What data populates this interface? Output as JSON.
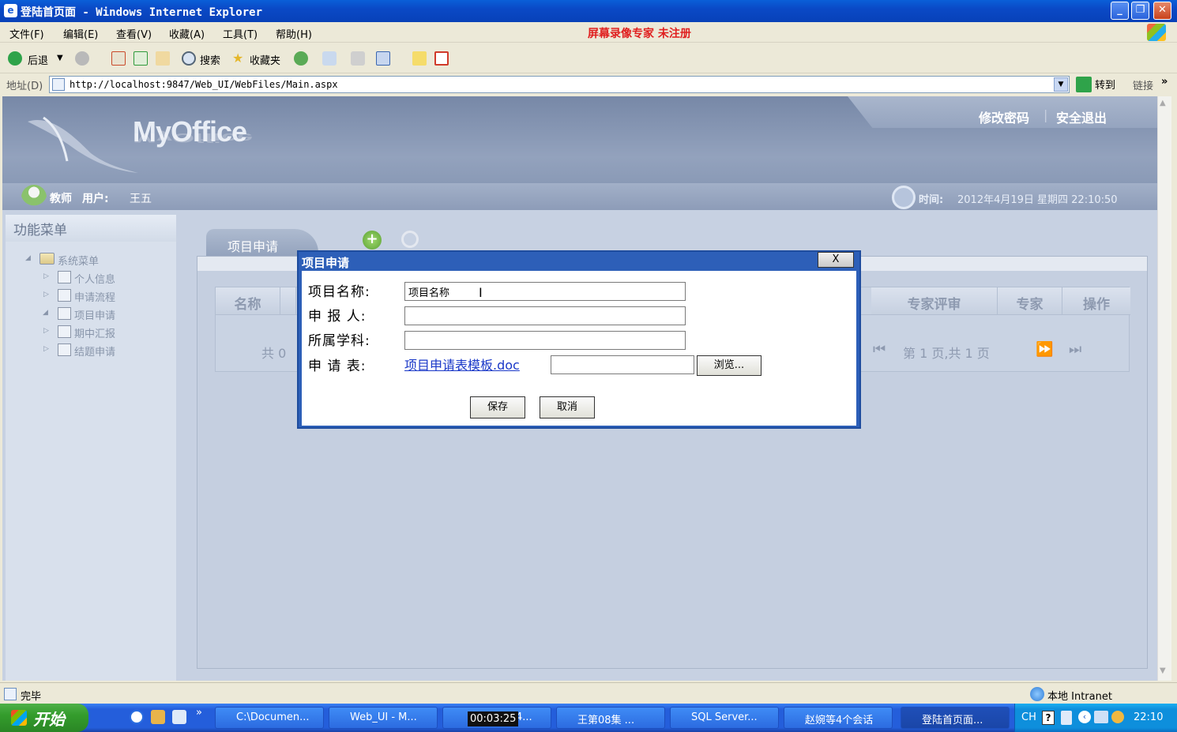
{
  "window": {
    "title": "登陆首页面 - Windows Internet Explorer",
    "min": "_",
    "max": "❐",
    "close": "✕"
  },
  "menubar": {
    "items": [
      "文件(F)",
      "编辑(E)",
      "查看(V)",
      "收藏(A)",
      "工具(T)",
      "帮助(H)"
    ],
    "recorder_watermark": "屏幕录像专家  未注册"
  },
  "toolbar": {
    "back": "后退",
    "search": "搜索",
    "favorites": "收藏夹"
  },
  "address": {
    "label": "地址(D)",
    "url": "http://localhost:9847/Web_UI/WebFiles/Main.aspx",
    "go": "转到",
    "links": "链接"
  },
  "header": {
    "logo": "MyOffice",
    "change_password": "修改密码",
    "separator": "|",
    "logout": "安全退出"
  },
  "userbar": {
    "role": "教师",
    "user_label": "用户:",
    "user_name": "王五",
    "time_label": "时间:",
    "time_value": "2012年4月19日 星期四 22:10:50"
  },
  "left_menu": {
    "title": "功能菜单",
    "root": "系统菜单",
    "items": [
      "个人信息",
      "申请流程",
      "项目申请",
      "期中汇报",
      "结题申请"
    ]
  },
  "main": {
    "tab": "项目申请",
    "grid_headers": [
      "名称",
      "专家评审",
      "专家",
      "操作"
    ],
    "pager_left": "共 0",
    "pager_right": "第 1 页,共 1 页"
  },
  "dialog": {
    "title": "项目申请",
    "close": "X",
    "fields": {
      "project_name": {
        "label": "项目名称:",
        "value": "项目名称"
      },
      "applicant": {
        "label": "申 报 人:",
        "value": ""
      },
      "discipline": {
        "label": "所属学科:",
        "value": ""
      },
      "form": {
        "label": "申 请 表:",
        "link": "项目申请表模板.doc",
        "file_value": "",
        "browse": "浏览..."
      }
    },
    "save": "保存",
    "cancel": "取消"
  },
  "statusbar": {
    "status": "完毕",
    "zone": "本地 Intranet"
  },
  "taskbar": {
    "start": "开始",
    "tasks": [
      "C:\\Documen...",
      "Web_UI - M...",
      "4...",
      "王第08集  ...",
      "SQL Server...",
      "赵婉等4个会话",
      "登陆首页面..."
    ],
    "recording_time": "00:03:25",
    "lang": "CH",
    "clock": "22:10"
  },
  "colors": {
    "xp_blue": "#0a49c6",
    "page_bg": "#c7d1e2",
    "dialog_title": "#2d5fb8",
    "link": "#1a38c8",
    "recorder_red": "#e02020"
  }
}
